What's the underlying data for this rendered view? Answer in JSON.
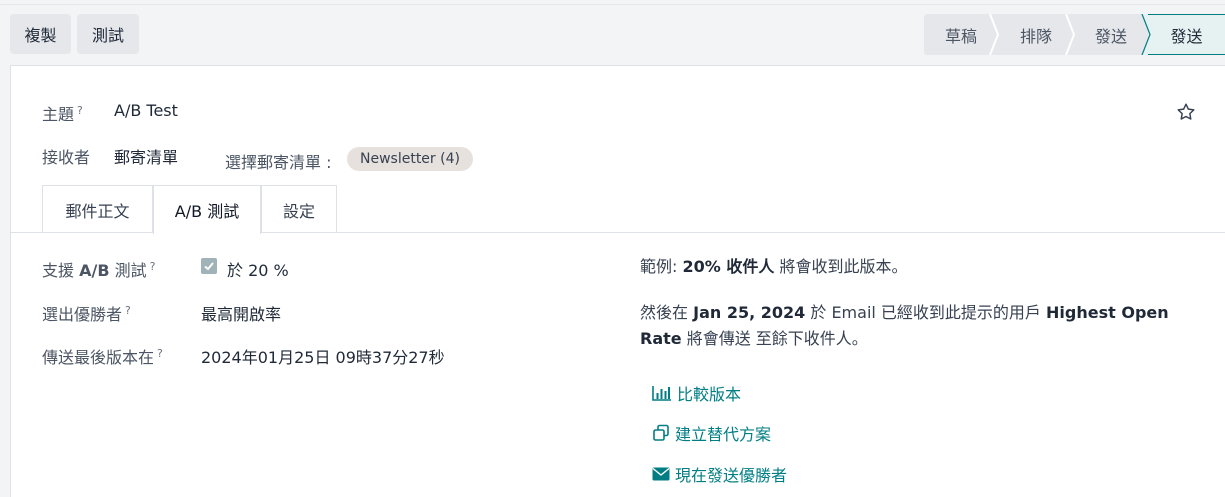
{
  "control": {
    "copy_label": "複製",
    "test_label": "測試"
  },
  "status_stages": [
    "草稿",
    "排隊",
    "發送",
    "發送"
  ],
  "status_active_index": 3,
  "form": {
    "subject_label": "主題",
    "subject_value": "A/B Test",
    "recipients_label": "接收者",
    "recipients_value": "郵寄清單",
    "mailing_list_label": "選擇郵寄清單 :",
    "mailing_list_tag": "Newsletter (4)",
    "help_mark": "?"
  },
  "tabs": [
    "郵件正文",
    "A/B 測試",
    "設定"
  ],
  "active_tab": 1,
  "ab": {
    "enable_label_pre": "支援 ",
    "enable_label_bold": "A/B",
    "enable_label_post": " 測試",
    "enable_checked": true,
    "percent_text": "於 20 %",
    "winner_label": "選出優勝者",
    "winner_value": "最高開啟率",
    "schedule_label": "傳送最後版本在",
    "schedule_value": "2024年01月25日 09時37分27秒"
  },
  "example": {
    "prefix": "範例:",
    "percent": "20% 收件人",
    "suffix": "將會收到此版本。",
    "then": "然後在",
    "date": "Jan 25, 2024",
    "mid": "於 Email 已經收到此提示的用戶",
    "winner": "Highest Open Rate",
    "end": "將會傳送 至餘下收件人。"
  },
  "actions": {
    "compare_label": "比較版本",
    "alternative_label": "建立替代方案",
    "send_winner_label": "現在發送優勝者"
  },
  "colors": {
    "accent": "#017e84",
    "active_stage_bg": "#e6f2f2",
    "tag_bg": "#e7e1de"
  }
}
